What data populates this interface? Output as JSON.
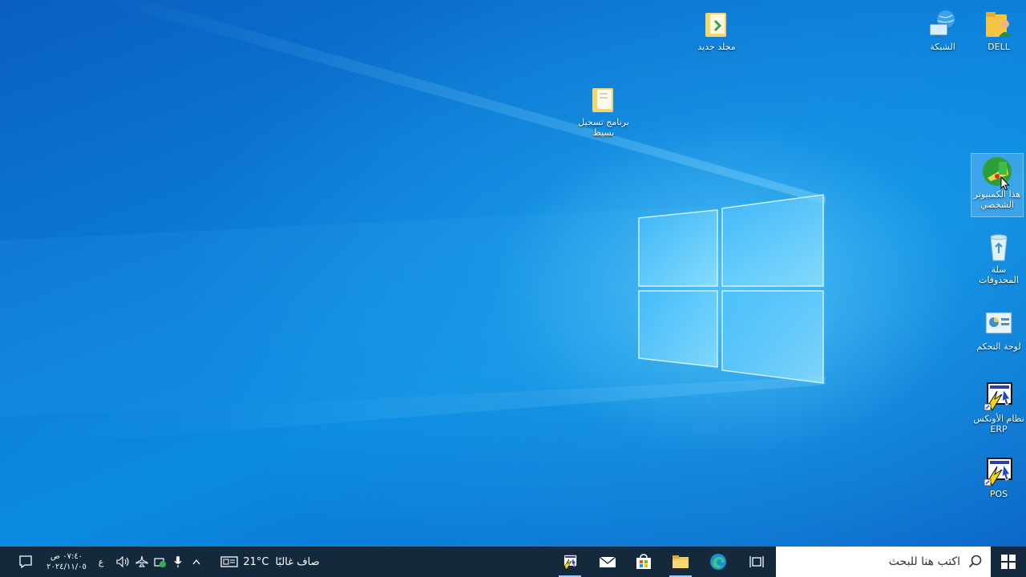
{
  "desktop": {
    "icons": [
      {
        "label": "DELL",
        "icon": "user-folder-icon"
      },
      {
        "label": "الشبكة",
        "icon": "network-icon"
      },
      {
        "label": "مجلد جديد",
        "icon": "folder-icon"
      },
      {
        "label": "برنامج تسجيل بسيط",
        "icon": "folder-icon"
      },
      {
        "label": "هذا الكمبيوتر الشخصي",
        "icon": "this-pc-icon"
      },
      {
        "label": "سلة المحذوفات",
        "icon": "recycle-bin-icon"
      },
      {
        "label": "لوحة التحكم",
        "icon": "control-panel-icon"
      },
      {
        "label": "نظام الأونكس ERP",
        "icon": "onyx-shortcut-icon"
      },
      {
        "label": "POS",
        "icon": "onyx-shortcut-icon"
      }
    ]
  },
  "taskbar": {
    "search_placeholder": "اكتب هنا للبحث",
    "weather": {
      "temp": "21°C",
      "condition": "صاف غالبًا"
    },
    "language": "ع",
    "clock": {
      "time": "٠٧:٤٠ ص",
      "date": "٢٠٢٤/١١/٠٥"
    }
  },
  "colors": {
    "taskbar_bg": "#14293c",
    "desktop_accent": "#0b82dc"
  }
}
